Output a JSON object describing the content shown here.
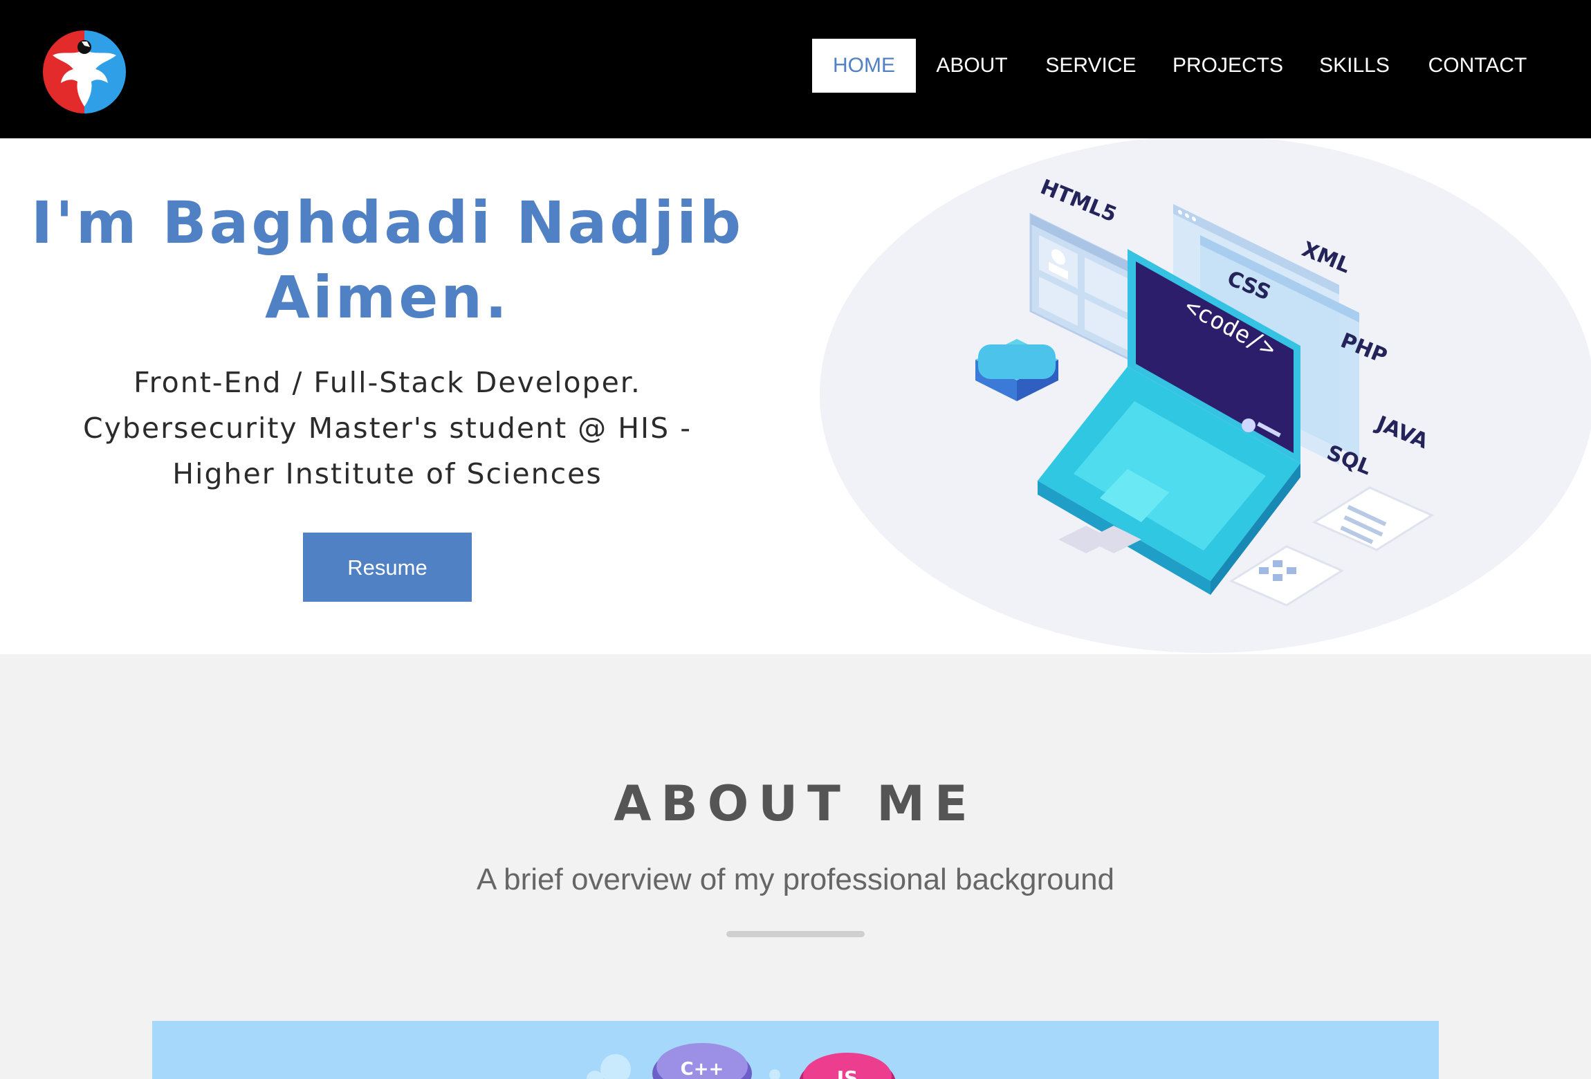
{
  "nav": {
    "items": [
      {
        "label": "HOME",
        "active": true
      },
      {
        "label": "ABOUT",
        "active": false
      },
      {
        "label": "SERVICE",
        "active": false
      },
      {
        "label": "PROJECTS",
        "active": false
      },
      {
        "label": "SKILLS",
        "active": false
      },
      {
        "label": "CONTACT",
        "active": false
      }
    ]
  },
  "hero": {
    "title_line1": "I'm Baghdadi Nadjib",
    "title_line2": "Aimen.",
    "subtitle_line1": "Front-End / Full-Stack Developer.",
    "subtitle_line2": "Cybersecurity Master's student @ HIS -",
    "subtitle_line3": "Higher Institute of Sciences",
    "resume_label": "Resume",
    "illustration": {
      "screen_code": "<code/>",
      "tags": [
        "HTML5",
        "CSS",
        "XML",
        "PHP",
        "JAVA",
        "SQL"
      ]
    }
  },
  "about": {
    "title": "ABOUT ME",
    "subtitle": "A brief overview of my professional background",
    "banner_tags": [
      "C++",
      "JS"
    ]
  },
  "colors": {
    "accent": "#4f81c4",
    "navbar": "#000000",
    "about_bg": "#f2f2f2",
    "banner": "#a6d8fb",
    "laptop": "#2fc7e2",
    "screen": "#2d1e6b"
  }
}
